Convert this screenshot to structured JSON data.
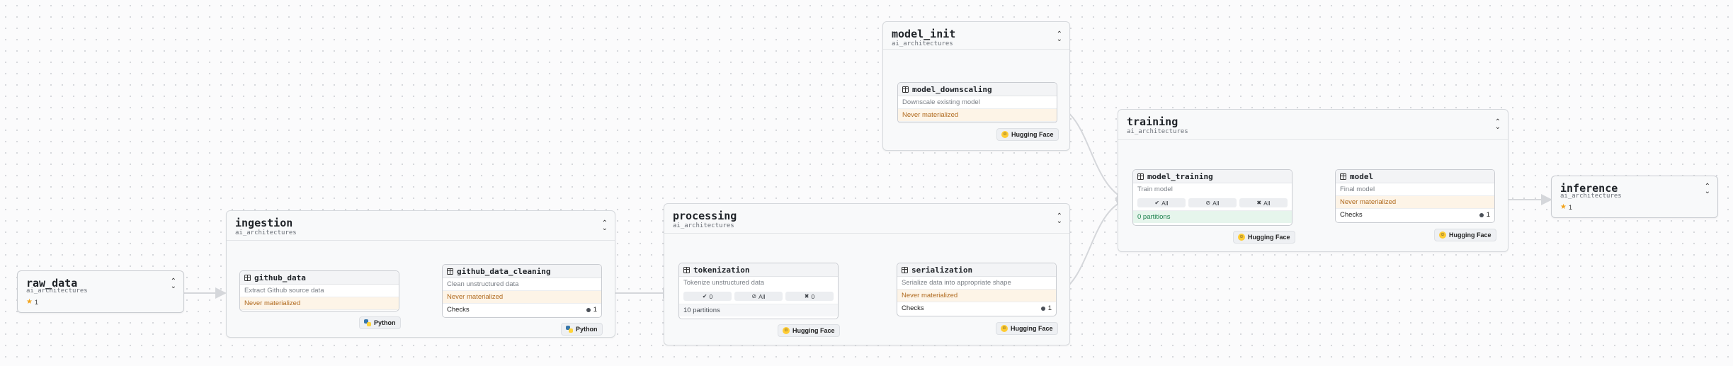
{
  "raw_data": {
    "title": "raw_data",
    "subtitle": "ai_architectures",
    "badge": "1"
  },
  "inference": {
    "title": "inference",
    "subtitle": "ai_architectures",
    "badge": "1"
  },
  "ingestion": {
    "title": "ingestion",
    "subtitle": "ai_architectures",
    "github_data": {
      "name": "github_data",
      "desc": "Extract Github source data",
      "status": "Never materialized",
      "tag": "Python"
    },
    "github_data_cleaning": {
      "name": "github_data_cleaning",
      "desc": "Clean unstructured data",
      "status": "Never materialized",
      "checks_label": "Checks",
      "checks_count": "1",
      "tag": "Python"
    }
  },
  "processing": {
    "title": "processing",
    "subtitle": "ai_architectures",
    "tokenization": {
      "name": "tokenization",
      "desc": "Tokenize unstructured data",
      "stats": [
        "0",
        "All",
        "0"
      ],
      "partitions": "10 partitions",
      "tag": "Hugging Face"
    },
    "serialization": {
      "name": "serialization",
      "desc": "Serialize data into appropriate shape",
      "status": "Never materialized",
      "checks_label": "Checks",
      "checks_count": "1",
      "tag": "Hugging Face"
    }
  },
  "model_init": {
    "title": "model_init",
    "subtitle": "ai_architectures",
    "model_downscaling": {
      "name": "model_downscaling",
      "desc": "Downscale existing model",
      "status": "Never materialized",
      "tag": "Hugging Face"
    }
  },
  "training": {
    "title": "training",
    "subtitle": "ai_architectures",
    "model_training": {
      "name": "model_training",
      "desc": "Train model",
      "stats": [
        "All",
        "All",
        "All"
      ],
      "partitions": "0 partitions",
      "tag": "Hugging Face"
    },
    "model": {
      "name": "model",
      "desc": "Final model",
      "status": "Never materialized",
      "checks_label": "Checks",
      "checks_count": "1",
      "tag": "Hugging Face"
    }
  },
  "colors": {
    "accent": "#f2a31b",
    "never_text": "#b06a1e",
    "never_bg": "#fdf4e7",
    "partitions_ok": "#1a7f4b",
    "edge": "#d5d7db"
  }
}
